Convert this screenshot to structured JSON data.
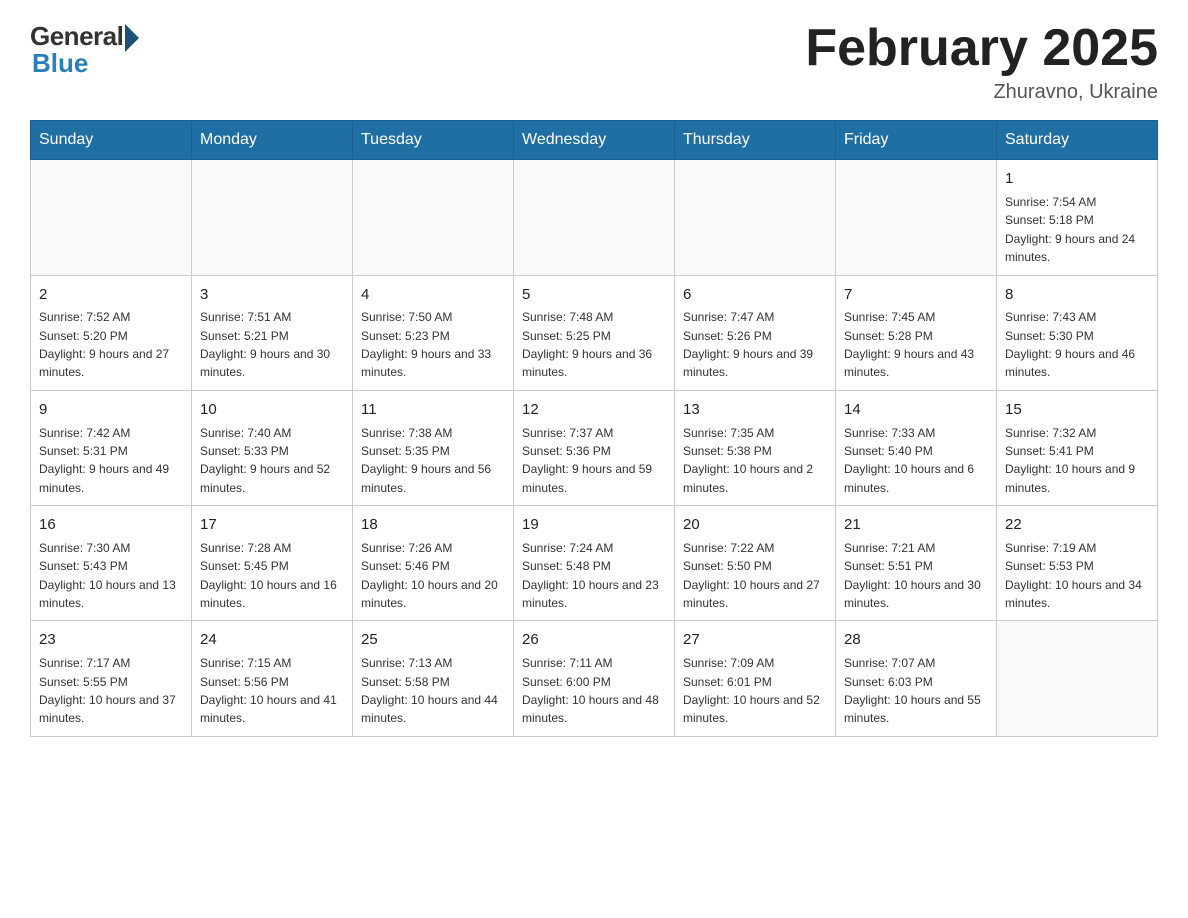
{
  "header": {
    "logo_general": "General",
    "logo_blue": "Blue",
    "month_title": "February 2025",
    "location": "Zhuravno, Ukraine"
  },
  "days_of_week": [
    "Sunday",
    "Monday",
    "Tuesday",
    "Wednesday",
    "Thursday",
    "Friday",
    "Saturday"
  ],
  "weeks": [
    [
      {
        "day": "",
        "info": ""
      },
      {
        "day": "",
        "info": ""
      },
      {
        "day": "",
        "info": ""
      },
      {
        "day": "",
        "info": ""
      },
      {
        "day": "",
        "info": ""
      },
      {
        "day": "",
        "info": ""
      },
      {
        "day": "1",
        "info": "Sunrise: 7:54 AM\nSunset: 5:18 PM\nDaylight: 9 hours and 24 minutes."
      }
    ],
    [
      {
        "day": "2",
        "info": "Sunrise: 7:52 AM\nSunset: 5:20 PM\nDaylight: 9 hours and 27 minutes."
      },
      {
        "day": "3",
        "info": "Sunrise: 7:51 AM\nSunset: 5:21 PM\nDaylight: 9 hours and 30 minutes."
      },
      {
        "day": "4",
        "info": "Sunrise: 7:50 AM\nSunset: 5:23 PM\nDaylight: 9 hours and 33 minutes."
      },
      {
        "day": "5",
        "info": "Sunrise: 7:48 AM\nSunset: 5:25 PM\nDaylight: 9 hours and 36 minutes."
      },
      {
        "day": "6",
        "info": "Sunrise: 7:47 AM\nSunset: 5:26 PM\nDaylight: 9 hours and 39 minutes."
      },
      {
        "day": "7",
        "info": "Sunrise: 7:45 AM\nSunset: 5:28 PM\nDaylight: 9 hours and 43 minutes."
      },
      {
        "day": "8",
        "info": "Sunrise: 7:43 AM\nSunset: 5:30 PM\nDaylight: 9 hours and 46 minutes."
      }
    ],
    [
      {
        "day": "9",
        "info": "Sunrise: 7:42 AM\nSunset: 5:31 PM\nDaylight: 9 hours and 49 minutes."
      },
      {
        "day": "10",
        "info": "Sunrise: 7:40 AM\nSunset: 5:33 PM\nDaylight: 9 hours and 52 minutes."
      },
      {
        "day": "11",
        "info": "Sunrise: 7:38 AM\nSunset: 5:35 PM\nDaylight: 9 hours and 56 minutes."
      },
      {
        "day": "12",
        "info": "Sunrise: 7:37 AM\nSunset: 5:36 PM\nDaylight: 9 hours and 59 minutes."
      },
      {
        "day": "13",
        "info": "Sunrise: 7:35 AM\nSunset: 5:38 PM\nDaylight: 10 hours and 2 minutes."
      },
      {
        "day": "14",
        "info": "Sunrise: 7:33 AM\nSunset: 5:40 PM\nDaylight: 10 hours and 6 minutes."
      },
      {
        "day": "15",
        "info": "Sunrise: 7:32 AM\nSunset: 5:41 PM\nDaylight: 10 hours and 9 minutes."
      }
    ],
    [
      {
        "day": "16",
        "info": "Sunrise: 7:30 AM\nSunset: 5:43 PM\nDaylight: 10 hours and 13 minutes."
      },
      {
        "day": "17",
        "info": "Sunrise: 7:28 AM\nSunset: 5:45 PM\nDaylight: 10 hours and 16 minutes."
      },
      {
        "day": "18",
        "info": "Sunrise: 7:26 AM\nSunset: 5:46 PM\nDaylight: 10 hours and 20 minutes."
      },
      {
        "day": "19",
        "info": "Sunrise: 7:24 AM\nSunset: 5:48 PM\nDaylight: 10 hours and 23 minutes."
      },
      {
        "day": "20",
        "info": "Sunrise: 7:22 AM\nSunset: 5:50 PM\nDaylight: 10 hours and 27 minutes."
      },
      {
        "day": "21",
        "info": "Sunrise: 7:21 AM\nSunset: 5:51 PM\nDaylight: 10 hours and 30 minutes."
      },
      {
        "day": "22",
        "info": "Sunrise: 7:19 AM\nSunset: 5:53 PM\nDaylight: 10 hours and 34 minutes."
      }
    ],
    [
      {
        "day": "23",
        "info": "Sunrise: 7:17 AM\nSunset: 5:55 PM\nDaylight: 10 hours and 37 minutes."
      },
      {
        "day": "24",
        "info": "Sunrise: 7:15 AM\nSunset: 5:56 PM\nDaylight: 10 hours and 41 minutes."
      },
      {
        "day": "25",
        "info": "Sunrise: 7:13 AM\nSunset: 5:58 PM\nDaylight: 10 hours and 44 minutes."
      },
      {
        "day": "26",
        "info": "Sunrise: 7:11 AM\nSunset: 6:00 PM\nDaylight: 10 hours and 48 minutes."
      },
      {
        "day": "27",
        "info": "Sunrise: 7:09 AM\nSunset: 6:01 PM\nDaylight: 10 hours and 52 minutes."
      },
      {
        "day": "28",
        "info": "Sunrise: 7:07 AM\nSunset: 6:03 PM\nDaylight: 10 hours and 55 minutes."
      },
      {
        "day": "",
        "info": ""
      }
    ]
  ]
}
